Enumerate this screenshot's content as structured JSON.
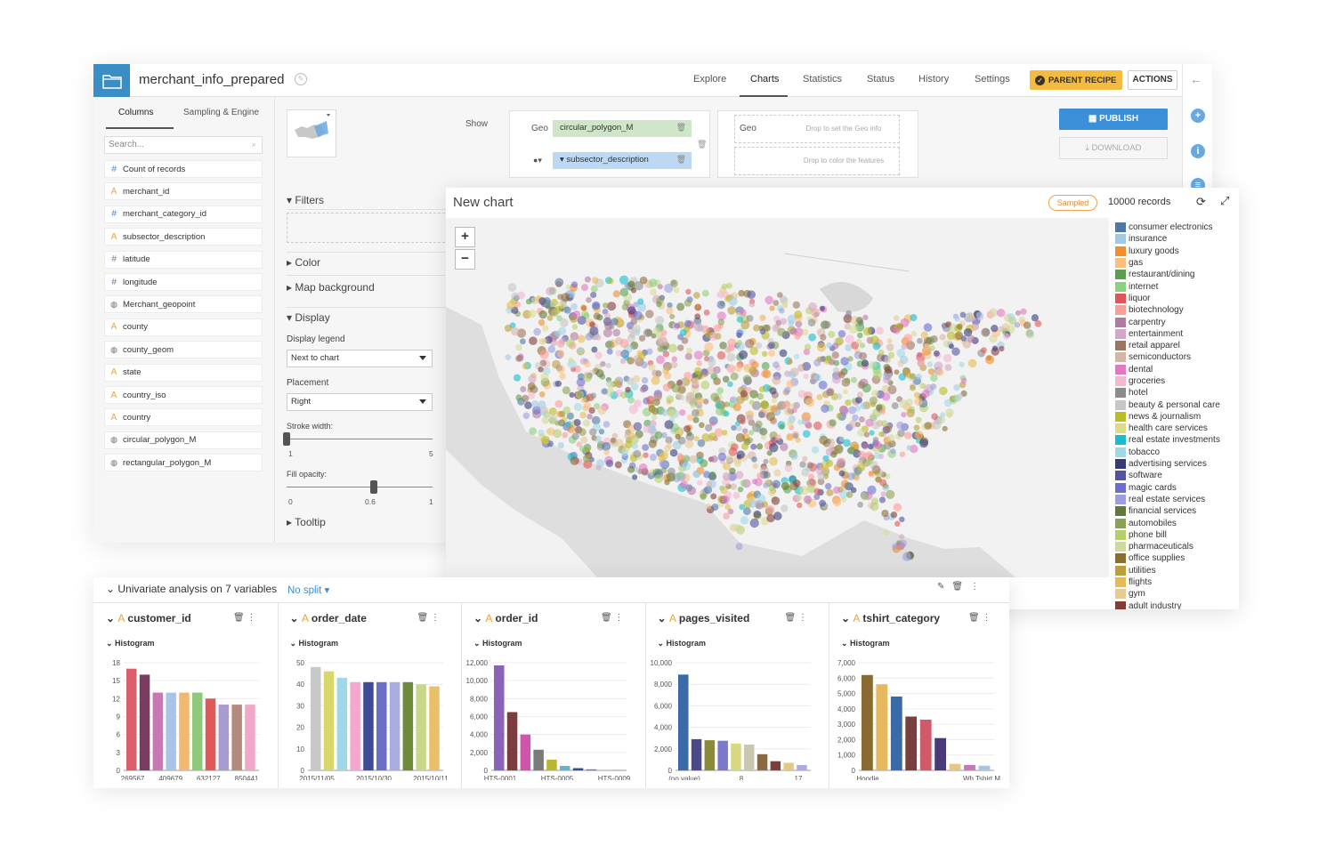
{
  "window": {
    "dataset_name": "merchant_info_prepared",
    "nav": [
      "Explore",
      "Charts",
      "Statistics",
      "Status",
      "History",
      "Settings"
    ],
    "parent_recipe": "PARENT RECIPE",
    "actions": "ACTIONS"
  },
  "left_panel": {
    "tabs": [
      "Columns",
      "Sampling & Engine"
    ],
    "search_placeholder": "Search...",
    "columns": [
      {
        "type": "num",
        "name": "Count of records"
      },
      {
        "type": "str",
        "name": "merchant_id"
      },
      {
        "type": "num",
        "name": "merchant_category_id"
      },
      {
        "type": "str",
        "name": "subsector_description"
      },
      {
        "type": "num",
        "name": "latitude"
      },
      {
        "type": "num",
        "name": "longitude"
      },
      {
        "type": "geo",
        "name": "Merchant_geopoint"
      },
      {
        "type": "str",
        "name": "county"
      },
      {
        "type": "geo",
        "name": "county_geom"
      },
      {
        "type": "str",
        "name": "state"
      },
      {
        "type": "str",
        "name": "country_iso"
      },
      {
        "type": "str",
        "name": "country"
      },
      {
        "type": "geo",
        "name": "circular_polygon_M"
      },
      {
        "type": "geo",
        "name": "rectangular_polygon_M"
      }
    ]
  },
  "settings": {
    "filters": "Filters",
    "color": "Color",
    "map_background": "Map background",
    "display": "Display",
    "display_legend_label": "Display legend",
    "display_legend_value": "Next to chart",
    "placement_label": "Placement",
    "placement_value": "Right",
    "stroke_width_label": "Stroke width:",
    "stroke_min": "1",
    "stroke_max": "5",
    "stroke_value": 1,
    "fill_opacity_label": "Fill opacity:",
    "fill_min": "0",
    "fill_mid": "0.6",
    "fill_max": "1",
    "fill_value": 0.6,
    "tooltip": "Tooltip"
  },
  "shelves": {
    "show": "Show",
    "geo_label": "Geo",
    "geo_field": "circular_polygon_M",
    "color_field": "subsector_description",
    "geo_label_2": "Geo",
    "geo_drop": "Drop to set the Geo info",
    "color_drop": "Drop to color the features",
    "publish": "PUBLISH",
    "download": "DOWNLOAD"
  },
  "chart_card": {
    "title": "New chart",
    "sampled": "Sampled",
    "records": "10000 records",
    "zoom_in": "+",
    "zoom_out": "−"
  },
  "legend": [
    {
      "label": "consumer electronics",
      "color": "#4e79a7"
    },
    {
      "label": "insurance",
      "color": "#a0cbe8"
    },
    {
      "label": "luxury goods",
      "color": "#f28e2b"
    },
    {
      "label": "gas",
      "color": "#ffbe7d"
    },
    {
      "label": "restaurant/dining",
      "color": "#59a14f"
    },
    {
      "label": "internet",
      "color": "#8cd17d"
    },
    {
      "label": "liquor",
      "color": "#e15759"
    },
    {
      "label": "biotechnology",
      "color": "#ff9d9a"
    },
    {
      "label": "carpentry",
      "color": "#b07aa1"
    },
    {
      "label": "entertainment",
      "color": "#d4a6c8"
    },
    {
      "label": "retail apparel",
      "color": "#9d7660"
    },
    {
      "label": "semiconductors",
      "color": "#d7b5a6"
    },
    {
      "label": "dental",
      "color": "#e377c2"
    },
    {
      "label": "groceries",
      "color": "#f7b6d2"
    },
    {
      "label": "hotel",
      "color": "#8c8c8c"
    },
    {
      "label": "beauty & personal care",
      "color": "#c7c7c7"
    },
    {
      "label": "news & journalism",
      "color": "#bcbd22"
    },
    {
      "label": "health care services",
      "color": "#dbdb8d"
    },
    {
      "label": "real estate investments",
      "color": "#17becf"
    },
    {
      "label": "tobacco",
      "color": "#9edae5"
    },
    {
      "label": "advertising services",
      "color": "#393b79"
    },
    {
      "label": "software",
      "color": "#5254a3"
    },
    {
      "label": "magic cards",
      "color": "#6b6ecf"
    },
    {
      "label": "real estate services",
      "color": "#9c9ede"
    },
    {
      "label": "financial services",
      "color": "#637939"
    },
    {
      "label": "automobiles",
      "color": "#8ca252"
    },
    {
      "label": "phone bill",
      "color": "#b5cf6b"
    },
    {
      "label": "pharmaceuticals",
      "color": "#cedb9c"
    },
    {
      "label": "office supplies",
      "color": "#8c6d31"
    },
    {
      "label": "utilities",
      "color": "#bd9e39"
    },
    {
      "label": "flights",
      "color": "#e7ba52"
    },
    {
      "label": "gym",
      "color": "#e7cb94"
    },
    {
      "label": "adult industry",
      "color": "#843c39"
    }
  ],
  "univariate": {
    "title": "Univariate analysis on 7 variables",
    "split": "No split",
    "histogram_label": "Histogram"
  },
  "chart_data": [
    {
      "type": "bar",
      "title": "customer_id",
      "ylim": [
        0,
        18
      ],
      "yticks": [
        "0",
        "3",
        "6",
        "9",
        "12",
        "15",
        "18"
      ],
      "xtick_labels": [
        "269567",
        "409679",
        "632127",
        "850441"
      ],
      "values": [
        17,
        16,
        13,
        13,
        13,
        13,
        12,
        11,
        11,
        11
      ],
      "colors": [
        "#d95f6a",
        "#7a3b61",
        "#c978b4",
        "#a8c4e8",
        "#f0b870",
        "#8fc97b",
        "#e05a5a",
        "#a99ad0",
        "#b48a7c",
        "#f2a7c9"
      ]
    },
    {
      "type": "bar",
      "title": "order_date",
      "ylim": [
        0,
        50
      ],
      "yticks": [
        "0",
        "10",
        "20",
        "30",
        "40",
        "50"
      ],
      "xtick_labels": [
        "2015/11/05",
        "2015/10/30",
        "2015/10/11"
      ],
      "values": [
        48,
        46,
        43,
        41,
        41,
        41,
        41,
        41,
        40,
        39
      ],
      "colors": [
        "#c8c8c8",
        "#d8d86a",
        "#9fd8e8",
        "#f2a8d0",
        "#3f4a99",
        "#6a70c8",
        "#a8acdf",
        "#6f8a3a",
        "#c8d88a",
        "#e8c06a"
      ]
    },
    {
      "type": "bar",
      "title": "order_id",
      "ylim": [
        0,
        12000
      ],
      "yticks": [
        "0",
        "2,000",
        "4,000",
        "6,000",
        "8,000",
        "10,000",
        "12,000"
      ],
      "xtick_labels": [
        "HTS-0001",
        "HTS-0005",
        "HTS-0009"
      ],
      "values": [
        11700,
        6500,
        4000,
        2300,
        1200,
        500,
        250,
        120,
        60,
        30
      ],
      "colors": [
        "#8a62b8",
        "#7b3e3e",
        "#d055a8",
        "#7a7a7a",
        "#b8b830",
        "#5ab8d0",
        "#3a4a90",
        "#6a70c8",
        "#a8acdf",
        "#6f8a3a"
      ]
    },
    {
      "type": "bar",
      "title": "pages_visited",
      "ylim": [
        0,
        10000
      ],
      "yticks": [
        "0",
        "2,000",
        "4,000",
        "6,000",
        "8,000",
        "10,000"
      ],
      "xtick_labels": [
        "(no value)",
        "8",
        "17"
      ],
      "values": [
        8900,
        2900,
        2800,
        2750,
        2500,
        2400,
        1500,
        850,
        700,
        500
      ],
      "colors": [
        "#3a6aaa",
        "#4a4a8a",
        "#8a8a3a",
        "#7a7ac8",
        "#d8d880",
        "#c8c8b0",
        "#8a6a40",
        "#7b3e3e",
        "#e8c880",
        "#a8acdf"
      ]
    },
    {
      "type": "bar",
      "title": "tshirt_category",
      "ylim": [
        0,
        7000
      ],
      "yticks": [
        "0",
        "1,000",
        "2,000",
        "3,000",
        "4,000",
        "5,000",
        "6,000",
        "7,000"
      ],
      "xtick_labels": [
        "Hoodie",
        "Wh Tshirt M"
      ],
      "values": [
        6200,
        5600,
        4800,
        3500,
        3300,
        2100,
        420,
        350,
        300
      ],
      "colors": [
        "#8a6a30",
        "#e8b860",
        "#3a6aaa",
        "#7b3e3e",
        "#d05a6a",
        "#4a3a7a",
        "#e8c880",
        "#c878b8",
        "#a8c4e8"
      ]
    }
  ]
}
